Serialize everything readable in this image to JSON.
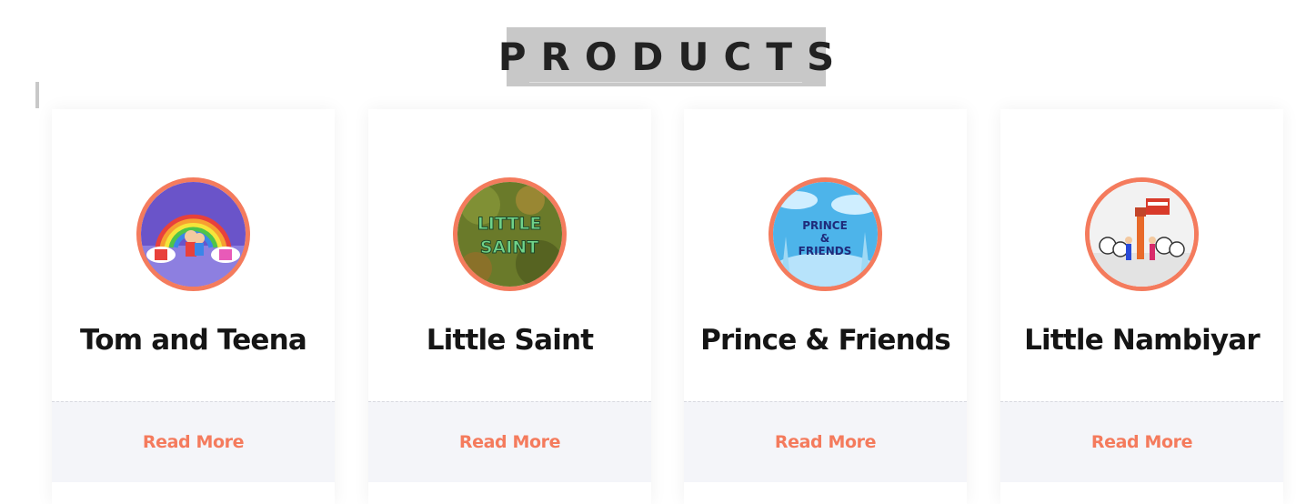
{
  "section": {
    "title": "PRODUCTS"
  },
  "colors": {
    "accent": "#f47b5d",
    "title_bg": "#c8c8c8",
    "footer_bg": "#f4f5f9",
    "heading_text": "#151515"
  },
  "products": [
    {
      "name": "Tom and Teena",
      "image_icon": "rainbow-cartoon-thumbnail",
      "read_more_label": "Read More"
    },
    {
      "name": "Little Saint",
      "image_icon": "little-saint-title-thumbnail",
      "image_text_1": "LITTLE",
      "image_text_2": "SAINT",
      "read_more_label": "Read More"
    },
    {
      "name": "Prince & Friends",
      "image_icon": "prince-friends-title-thumbnail",
      "image_text_1": "PRINCE",
      "image_text_2": "&",
      "image_text_3": "FRIENDS",
      "read_more_label": "Read More"
    },
    {
      "name": "Little Nambiyar",
      "image_icon": "little-nambiyar-cartoon-thumbnail",
      "read_more_label": "Read More"
    }
  ]
}
